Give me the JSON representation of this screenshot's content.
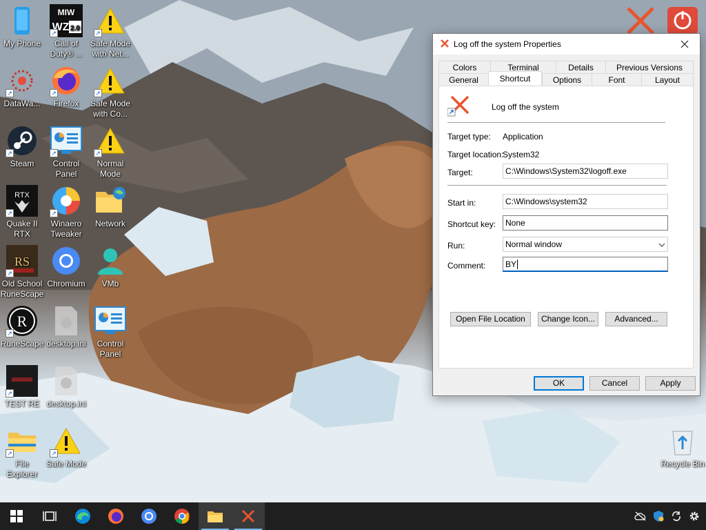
{
  "desktop": {
    "icons": [
      {
        "label": "My Phone"
      },
      {
        "label": "Call of Duty® ..."
      },
      {
        "label": "Safe Mode with Net..."
      },
      {
        "label": "DataWa..."
      },
      {
        "label": "Firefox"
      },
      {
        "label": "Safe Mode with Co..."
      },
      {
        "label": "Steam"
      },
      {
        "label": "Control Panel"
      },
      {
        "label": "Normal Mode"
      },
      {
        "label": "Quake II RTX"
      },
      {
        "label": "Winaero Tweaker"
      },
      {
        "label": "Network"
      },
      {
        "label": "Old School RuneScape"
      },
      {
        "label": "Chromium"
      },
      {
        "label": "VMb"
      },
      {
        "label": "RuneScape"
      },
      {
        "label": "desktop.ini"
      },
      {
        "label": "Control Panel"
      },
      {
        "label": "TEST RE"
      },
      {
        "label": "desktop.ini"
      },
      {
        "label": "File Explorer"
      },
      {
        "label": "Safe Mode"
      },
      {
        "label": "Recycle Bin"
      }
    ],
    "wz_badge": "WZ",
    "wz_version": "2.0",
    "mw_text": "MIW",
    "rtx_text": "RTX",
    "rs_text": "RS"
  },
  "dialog": {
    "title": "Log off the system Properties",
    "tabs_row1": [
      "Colors",
      "Terminal",
      "Details",
      "Previous Versions"
    ],
    "tabs_row2": [
      "General",
      "Shortcut",
      "Options",
      "Font",
      "Layout"
    ],
    "shortcut_name": "Log off the system",
    "labels": {
      "target_type": "Target type:",
      "target_location": "Target location:",
      "target": "Target:",
      "start_in": "Start in:",
      "shortcut_key": "Shortcut key:",
      "run": "Run:",
      "comment": "Comment:"
    },
    "values": {
      "target_type": "Application",
      "target_location": "System32",
      "target": "C:\\Windows\\System32\\logoff.exe",
      "start_in": "C:\\Windows\\system32",
      "shortcut_key": "None",
      "run": "Normal window",
      "comment": "BY"
    },
    "buttons": {
      "open_file_location": "Open File Location",
      "change_icon": "Change Icon...",
      "advanced": "Advanced...",
      "ok": "OK",
      "cancel": "Cancel",
      "apply": "Apply"
    }
  },
  "taskbar": {
    "items": [
      "start",
      "task-view",
      "edge",
      "firefox",
      "chromium",
      "chrome",
      "file-explorer",
      "logoff"
    ]
  }
}
